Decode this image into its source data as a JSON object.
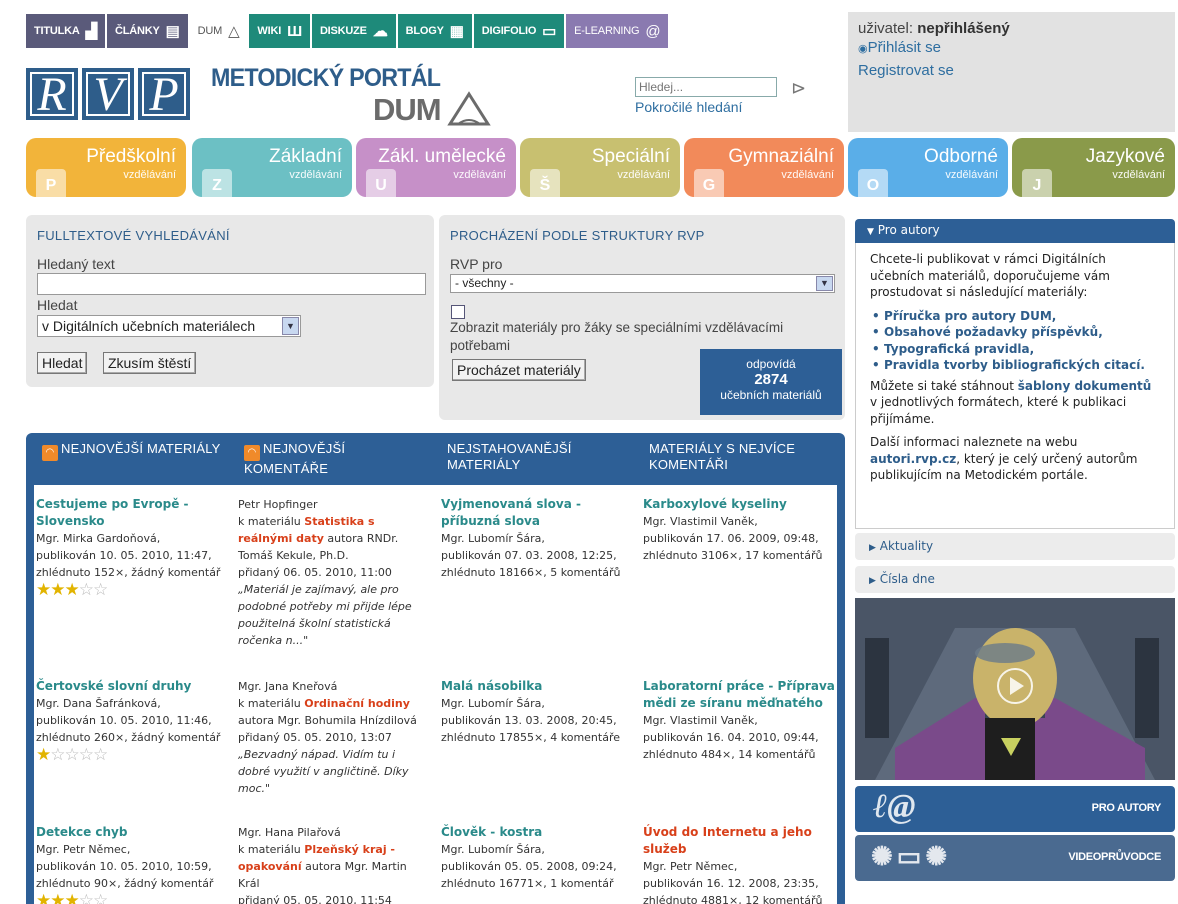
{
  "nav": {
    "tabs": [
      {
        "label": "TITULKA",
        "color": "#5a5a7a"
      },
      {
        "label": "ČLÁNKY",
        "color": "#5a5a7a"
      },
      {
        "label": "DUM",
        "color": "#ffffff"
      },
      {
        "label": "WIKI",
        "color": "#1e8a7a"
      },
      {
        "label": "DISKUZE",
        "color": "#1e8a7a"
      },
      {
        "label": "BLOGY",
        "color": "#1e8a7a"
      },
      {
        "label": "DIGIFOLIO",
        "color": "#1e8a7a"
      },
      {
        "label": "E-LEARNING",
        "color": "#8a7ab0"
      }
    ]
  },
  "logo": {
    "letters": [
      "R",
      "V",
      "P"
    ],
    "title": "METODICKÝ PORTÁL",
    "subtitle": "DUM"
  },
  "search": {
    "placeholder": "Hledej...",
    "advanced": "Pokročilé hledání"
  },
  "user": {
    "label": "uživatel:",
    "name": "nepřihlášený",
    "login": "Přihlásit se",
    "register": "Registrovat se"
  },
  "categories": [
    {
      "title": "Předškolní",
      "sub": "vzdělávání",
      "letter": "P",
      "color": "#f2b43a"
    },
    {
      "title": "Základní",
      "sub": "vzdělávání",
      "letter": "Z",
      "color": "#6cc0c4"
    },
    {
      "title": "Zákl. umělecké",
      "sub": "vzdělávání",
      "letter": "U",
      "color": "#c690c8"
    },
    {
      "title": "Speciální",
      "sub": "vzdělávání",
      "letter": "Š",
      "color": "#c8c070"
    },
    {
      "title": "Gymnaziální",
      "sub": "vzdělávání",
      "letter": "G",
      "color": "#f28a5a"
    },
    {
      "title": "Odborné",
      "sub": "vzdělávání",
      "letter": "O",
      "color": "#5aaee8"
    },
    {
      "title": "Jazykové",
      "sub": "vzdělávání",
      "letter": "J",
      "color": "#8a9a4a"
    }
  ],
  "fulltext": {
    "heading": "FULLTEXTOVÉ VYHLEDÁVÁNÍ",
    "text_label": "Hledaný text",
    "where_label": "Hledat",
    "where_value": "v Digitálních učebních materiálech",
    "search_btn": "Hledat",
    "lucky_btn": "Zkusím štěstí"
  },
  "browse": {
    "heading": "PROCHÁZENÍ PODLE STRUKTURY RVP",
    "rvp_label": "RVP pro",
    "rvp_value": "- všechny -",
    "special_label": "Zobrazit materiály pro žáky se speciálními vzdělávacími potřebami",
    "browse_btn": "Procházet materiály",
    "count_top": "odpovídá",
    "count": "2874",
    "count_bottom": "učebních materiálů"
  },
  "materials": {
    "headers": [
      "NEJNOVĚJŠÍ MATERIÁLY",
      "NEJNOVĚJŠÍ KOMENTÁŘE",
      "NEJSTAHOVANĚJŠÍ MATERIÁLY",
      "MATERIÁLY S NEJVÍCE KOMENTÁŘI"
    ],
    "newest": [
      {
        "title": "Cestujeme po Evropě - Slovensko",
        "author": "Mgr. Mirka Gardoňová,",
        "published": "publikován 10. 05. 2010, 11:47,",
        "stats": "zhlédnuto 152×, žádný komentář",
        "rating": 3
      },
      {
        "title": "Čertovské slovní druhy",
        "author": "Mgr. Dana Šafránková,",
        "published": "publikován 10. 05. 2010, 11:46,",
        "stats": "zhlédnuto 260×, žádný komentář",
        "rating": 1
      },
      {
        "title": "Detekce chyb",
        "author": "Mgr. Petr Němec,",
        "published": "publikován 10. 05. 2010, 10:59,",
        "stats": "zhlédnuto 90×, žádný komentář",
        "rating": 3
      }
    ],
    "comments": [
      {
        "who": "Petr Hopfinger",
        "k": "k materiálu",
        "material": "Statistika s reálnými daty",
        "by": "autora RNDr. Tomáš Kekule, Ph.D.",
        "added": "přidaný 06. 05. 2010, 11:00",
        "quote": "„Materiál je zajímavý, ale pro podobné potřeby mi přijde lépe použitelná školní statistická ročenka n...\""
      },
      {
        "who": "Mgr. Jana Kneřová",
        "k": "k materiálu",
        "material": "Ordinační hodiny",
        "by": "autora Mgr. Bohumila Hnízdilová",
        "added": "přidaný 05. 05. 2010, 13:07",
        "quote": "„Bezvadný nápad. Vidím tu i dobré využití v angličtině. Díky moc.\""
      },
      {
        "who": "Mgr. Hana Pilařová",
        "k": "k materiálu",
        "material": "Plzeňský kraj - opakování",
        "by": "autora Mgr. Martin Král",
        "added": "přidaný 05. 05. 2010, 11:54",
        "quote": ""
      }
    ],
    "downloaded": [
      {
        "title": "Vyjmenovaná slova - příbuzná slova",
        "author": "Mgr. Lubomír Šára,",
        "published": "publikován 07. 03. 2008, 12:25,",
        "stats": "zhlédnuto 18166×, 5 komentářů"
      },
      {
        "title": "Malá násobilka",
        "author": "Mgr. Lubomír Šára,",
        "published": "publikován 13. 03. 2008, 20:45,",
        "stats": "zhlédnuto 17855×, 4 komentáře"
      },
      {
        "title": "Člověk - kostra",
        "author": "Mgr. Lubomír Šára,",
        "published": "publikován 05. 05. 2008, 09:24,",
        "stats": "zhlédnuto 16771×, 1 komentář"
      }
    ],
    "most_commented": [
      {
        "title": "Karboxylové kyseliny",
        "author": "Mgr. Vlastimil Vaněk,",
        "published": "publikován 17. 06. 2009, 09:48,",
        "stats": "zhlédnuto 3106×, 17 komentářů"
      },
      {
        "title": "Laboratorní práce - Příprava mědi ze síranu měďnatého",
        "author": "Mgr. Vlastimil Vaněk,",
        "published": "publikován 16. 04. 2010, 09:44,",
        "stats": "zhlédnuto 484×, 14 komentářů"
      },
      {
        "title": "Úvod do Internetu a jeho služeb",
        "author": "Mgr. Petr Němec,",
        "published": "publikován 16. 12. 2008, 23:35,",
        "stats": "zhlédnuto 4881×, 12 komentářů"
      }
    ]
  },
  "sidebar": {
    "pro_autory": {
      "heading": "Pro autory",
      "intro": "Chcete-li publikovat v rámci Digitálních učebních materiálů, doporučujeme vám prostudovat si následující materiály:",
      "links": [
        "Příručka pro autory DUM,",
        "Obsahové požadavky příspěvků,",
        "Typografická pravidla,",
        "Pravidla tvorby bibliografických citací."
      ],
      "templates_pre": "Můžete si také stáhnout",
      "templates_link": "šablony dokumentů",
      "templates_post": "v jednotlivých formátech, které k publikaci přijímáme.",
      "more_pre": "Další informaci naleznete na webu",
      "more_link": "autori.rvp.cz",
      "more_post": ", který je celý určený autorům publikujícím na Metodickém portále."
    },
    "aktuality": "Aktuality",
    "cisla_dne": "Čísla dne",
    "promo1": "PRO AUTORY",
    "promo2": "VIDEOPRŮVODCE"
  }
}
